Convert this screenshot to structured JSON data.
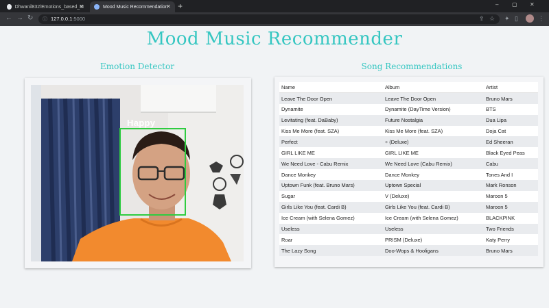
{
  "browser": {
    "tabs": [
      {
        "label": "Dhwanil832/Emotions_based_M",
        "active": false
      },
      {
        "label": "Mood Music Recommendation",
        "active": true
      }
    ],
    "new_tab": "+",
    "window_controls": [
      "–",
      "▢",
      "✕"
    ],
    "url_host": "127.0.0.1",
    "url_port": ":5000",
    "icons": [
      "back-icon",
      "forward-icon",
      "reload-icon",
      "lock-icon",
      "share-icon",
      "star-icon",
      "extensions-icon",
      "sidepanel-icon",
      "profile-avatar",
      "menu-icon"
    ]
  },
  "page": {
    "title": "Mood Music Recommender",
    "left_section_title": "Emotion Detector",
    "right_section_title": "Song Recommendations"
  },
  "detector": {
    "emotion_label": "Happy",
    "box_color": "#2ecc40"
  },
  "table": {
    "headers": [
      "Name",
      "Album",
      "Artist"
    ],
    "rows": [
      {
        "name": "Leave The Door Open",
        "album": "Leave The Door Open",
        "artist": "Bruno Mars"
      },
      {
        "name": "Dynamite",
        "album": "Dynamite (DayTime Version)",
        "artist": "BTS"
      },
      {
        "name": "Levitating (feat. DaBaby)",
        "album": "Future Nostalgia",
        "artist": "Dua Lipa"
      },
      {
        "name": "Kiss Me More (feat. SZA)",
        "album": "Kiss Me More (feat. SZA)",
        "artist": "Doja Cat"
      },
      {
        "name": "Perfect",
        "album": "÷ (Deluxe)",
        "artist": "Ed Sheeran"
      },
      {
        "name": "GIRL LIKE ME",
        "album": "GIRL LIKE ME",
        "artist": "Black Eyed Peas"
      },
      {
        "name": "We Need Love - Cabu Remix",
        "album": "We Need Love (Cabu Remix)",
        "artist": "Cabu"
      },
      {
        "name": "Dance Monkey",
        "album": "Dance Monkey",
        "artist": "Tones And I"
      },
      {
        "name": "Uptown Funk (feat. Bruno Mars)",
        "album": "Uptown Special",
        "artist": "Mark Ronson"
      },
      {
        "name": "Sugar",
        "album": "V (Deluxe)",
        "artist": "Maroon 5"
      },
      {
        "name": "Girls Like You (feat. Cardi B)",
        "album": "Girls Like You (feat. Cardi B)",
        "artist": "Maroon 5"
      },
      {
        "name": "Ice Cream (with Selena Gomez)",
        "album": "Ice Cream (with Selena Gomez)",
        "artist": "BLACKPINK"
      },
      {
        "name": "Useless",
        "album": "Useless",
        "artist": "Two Friends"
      },
      {
        "name": "Roar",
        "album": "PRISM (Deluxe)",
        "artist": "Katy Perry"
      },
      {
        "name": "The Lazy Song",
        "album": "Doo-Wops & Hooligans",
        "artist": "Bruno Mars"
      }
    ]
  },
  "colors": {
    "accent": "#35c6c1",
    "chrome_dark": "#202124",
    "chrome_mid": "#35363a"
  }
}
